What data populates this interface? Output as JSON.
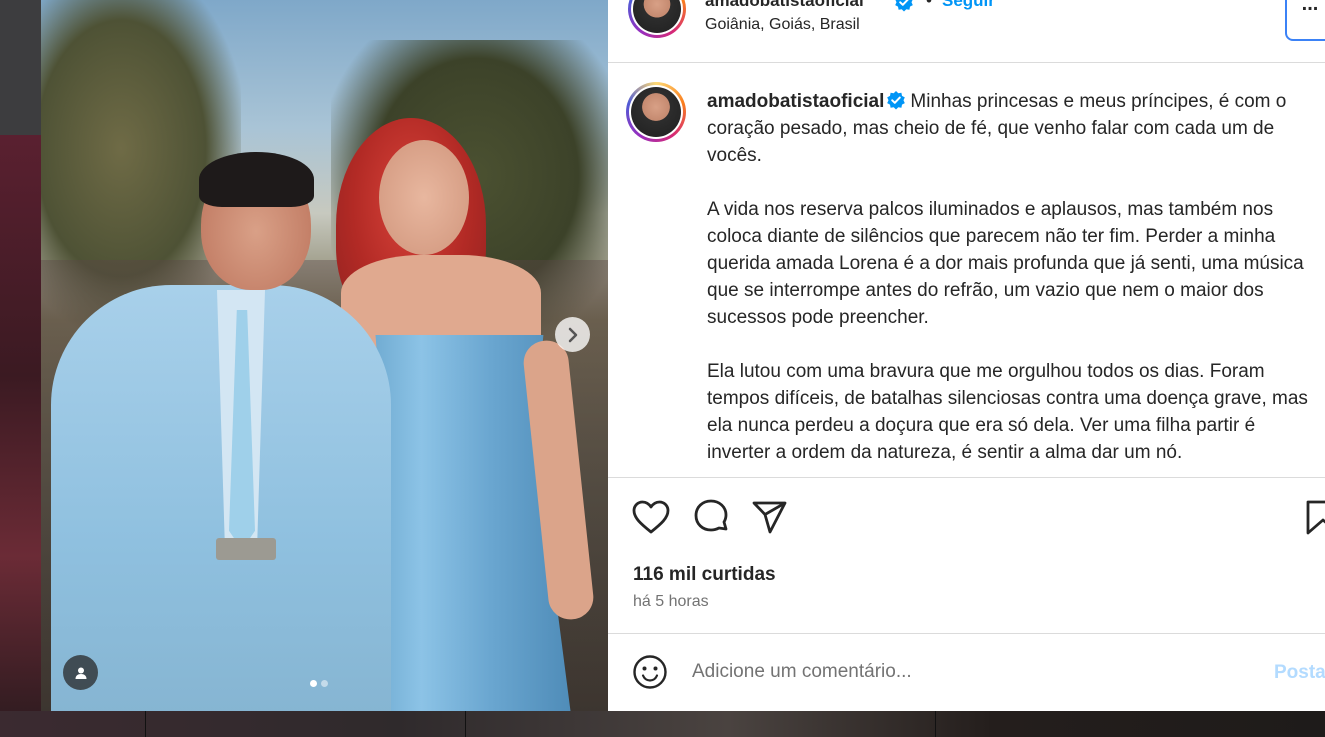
{
  "post": {
    "username": "amadobatistaoficial",
    "location": "Goiânia, Goiás, Brasil",
    "follow_label": "Seguir",
    "separator": "•",
    "more_label": "...",
    "caption": {
      "username": "amadobatistaoficial",
      "paragraphs": [
        "Minhas princesas e meus príncipes, é com o coração pesado, mas cheio de fé, que venho falar com cada um de vocês.",
        "A vida nos reserva palcos iluminados e aplausos, mas também nos coloca diante de silêncios que parecem não ter fim. Perder a minha querida amada Lorena é a dor mais profunda que já senti, uma música que se interrompe antes do refrão, um vazio que nem o maior dos sucessos pode preencher.",
        "Ela lutou com uma bravura que me orgulhou todos os dias. Foram tempos difíceis, de batalhas silenciosas contra uma doença grave, mas ela nunca perdeu a doçura que era só dela. Ver uma filha partir é inverter a ordem da natureza, é sentir a alma dar um nó."
      ]
    },
    "likes": "116 mil curtidas",
    "time": "há 5 horas",
    "comment": {
      "placeholder": "Adicione um comentário...",
      "post_label": "Postar"
    },
    "carousel": {
      "total": 2,
      "current": 1
    },
    "colors": {
      "accent": "#0095f6",
      "post_disabled": "#b3dbff",
      "verified": "#0095f6"
    },
    "icons": {
      "like": "heart-icon",
      "comment": "comment-icon",
      "share": "send-icon",
      "save": "bookmark-icon",
      "emoji": "emoji-icon",
      "next": "chevron-right-icon",
      "tag": "user-tag-icon",
      "verified": "verified-badge-icon"
    }
  }
}
